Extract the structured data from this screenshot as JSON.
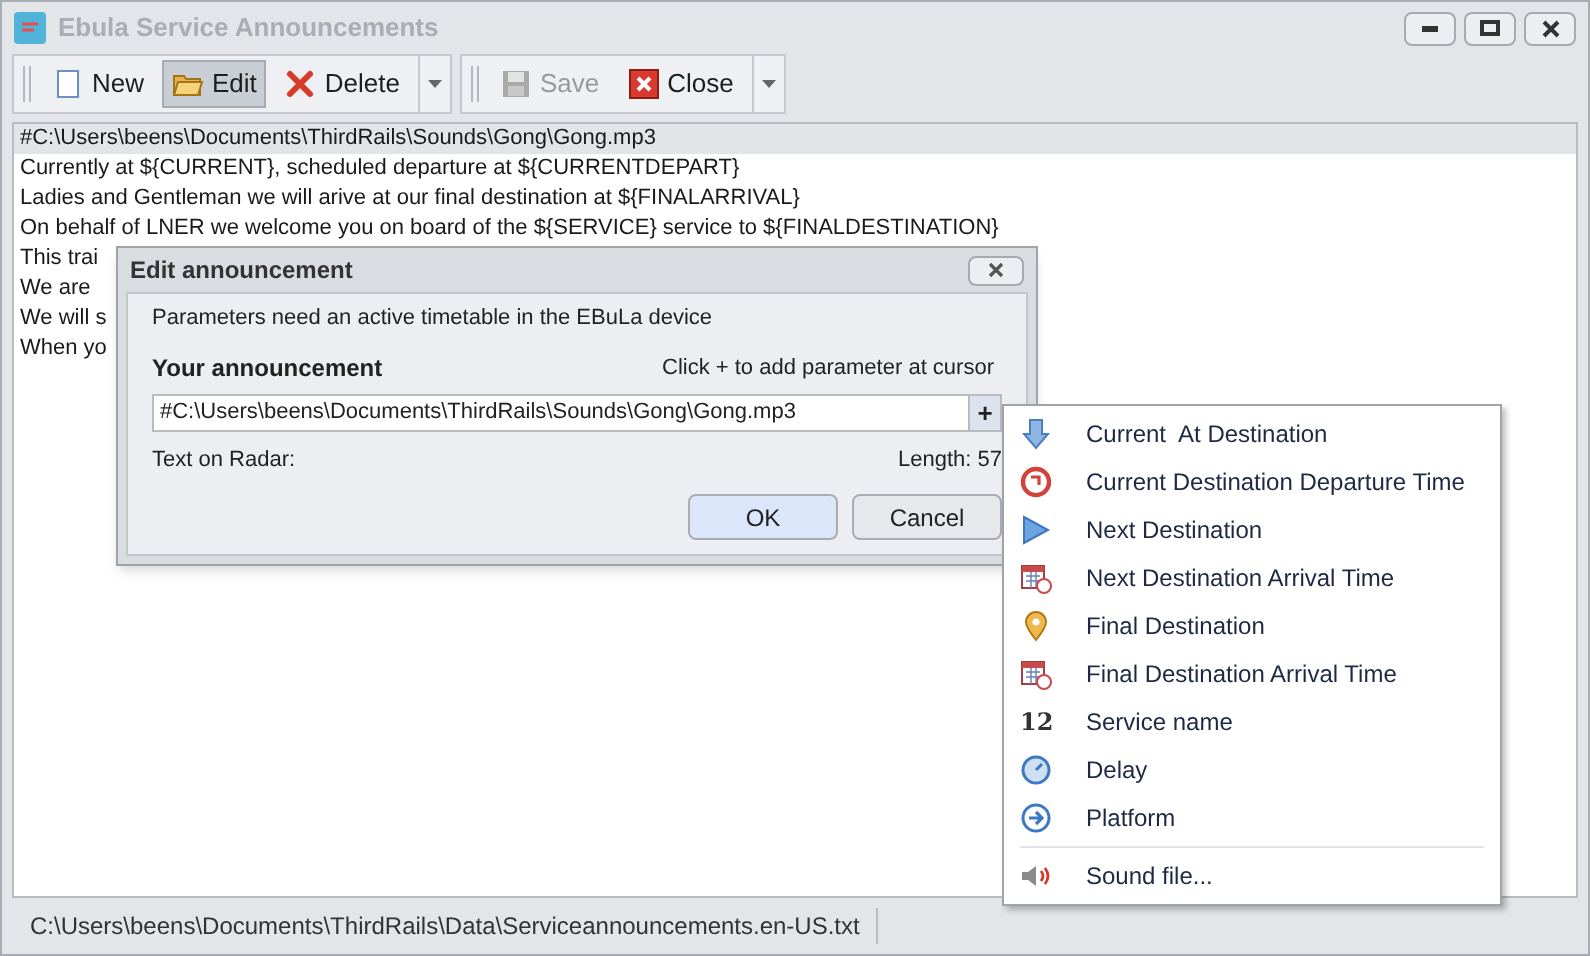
{
  "window": {
    "title": "Ebula Service Announcements"
  },
  "toolbar": [
    {
      "label": "New",
      "selected": false,
      "disabled": false
    },
    {
      "label": "Edit",
      "selected": true,
      "disabled": false
    },
    {
      "label": "Delete",
      "selected": false,
      "disabled": false
    },
    {
      "label": "Save",
      "selected": false,
      "disabled": true
    },
    {
      "label": "Close",
      "selected": false,
      "disabled": false
    }
  ],
  "lines": [
    {
      "text": "#C:\\Users\\beens\\Documents\\ThirdRails\\Sounds\\Gong\\Gong.mp3",
      "selected": true
    },
    {
      "text": "Currently at ${CURRENT}, scheduled departure at ${CURRENTDEPART}",
      "selected": false
    },
    {
      "text": "Ladies and Gentleman we will arive at our final destination at ${FINALARRIVAL}",
      "selected": false
    },
    {
      "text": "On behalf of LNER we welcome you on board of the ${SERVICE} service to ${FINALDESTINATION}",
      "selected": false
    },
    {
      "text": "This trai",
      "selected": false
    },
    {
      "text": "We are",
      "selected": false
    },
    {
      "text": "We will s",
      "selected": false
    },
    {
      "text": "When yo",
      "selected": false
    }
  ],
  "dialog": {
    "title": "Edit announcement",
    "info": "Parameters need an active timetable in the EBuLa device",
    "label": "Your announcement",
    "hint": "Click + to add parameter at cursor",
    "value": "#C:\\Users\\beens\\Documents\\ThirdRails\\Sounds\\Gong\\Gong.mp3",
    "add": "+",
    "radar_label": "Text on Radar:",
    "length": "Length: 57",
    "buttons": [
      "OK",
      "Cancel"
    ]
  },
  "menu": [
    {
      "label": "Current  At Destination",
      "kind": "parameter"
    },
    {
      "label": "Current Destination Departure Time",
      "kind": "parameter"
    },
    {
      "label": "Next Destination",
      "kind": "parameter"
    },
    {
      "label": "Next Destination Arrival Time",
      "kind": "parameter"
    },
    {
      "label": "Final Destination",
      "kind": "parameter"
    },
    {
      "label": "Final Destination Arrival Time",
      "kind": "parameter"
    },
    {
      "label": "Service name",
      "kind": "parameter",
      "icon_text": "12"
    },
    {
      "label": "Delay",
      "kind": "parameter"
    },
    {
      "label": "Platform",
      "kind": "parameter"
    },
    {
      "label": "Sound file...",
      "kind": "file"
    }
  ],
  "status_bar": {
    "path": "C:\\Users\\beens\\Documents\\ThirdRails\\Data\\Serviceannouncements.en-US.txt"
  }
}
